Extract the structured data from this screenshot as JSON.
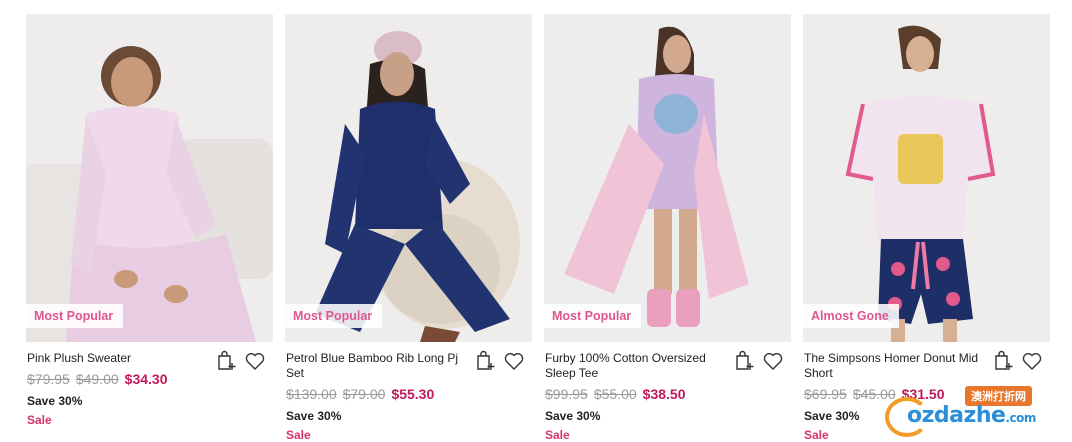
{
  "products": [
    {
      "badge": "Most Popular",
      "title": "Pink Plush Sweater",
      "prices": [
        "$79.95",
        "$49.00"
      ],
      "current": "$34.30",
      "save": "Save 30%",
      "sale": "Sale",
      "icons": [
        "shopping-bag-add-icon",
        "heart-icon"
      ]
    },
    {
      "badge": "Most Popular",
      "title": "Petrol Blue Bamboo Rib Long Pj Set",
      "prices": [
        "$139.00",
        "$79.00"
      ],
      "current": "$55.30",
      "save": "Save 30%",
      "sale": "Sale",
      "icons": [
        "shopping-bag-add-icon",
        "heart-icon"
      ]
    },
    {
      "badge": "Most Popular",
      "title": "Furby 100% Cotton Oversized Sleep Tee",
      "prices": [
        "$99.95",
        "$55.00"
      ],
      "current": "$38.50",
      "save": "Save 30%",
      "sale": "Sale",
      "icons": [
        "shopping-bag-add-icon",
        "heart-icon"
      ]
    },
    {
      "badge": "Almost Gone",
      "title": "The Simpsons Homer Donut Mid Short",
      "prices": [
        "$69.95",
        "$45.00"
      ],
      "current": "$31.50",
      "save": "Save 30%",
      "sale": "Sale",
      "icons": [
        "shopping-bag-add-icon",
        "heart-icon"
      ]
    }
  ],
  "watermark": {
    "top": "澳洲打折网",
    "main": "ozdazhe",
    "suffix": ".com"
  },
  "colors": {
    "badge_text": "#e0578f",
    "price_now": "#c2185b",
    "sale": "#d6336c",
    "strike": "#9a9a9a"
  }
}
